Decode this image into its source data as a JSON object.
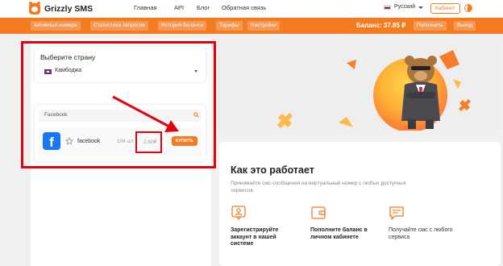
{
  "header": {
    "brand": "Grizzly SMS",
    "nav": [
      "Главная",
      "API",
      "Блог",
      "Обратная связь"
    ],
    "language": "Русский",
    "cabinet_label": "Кабинет"
  },
  "subnav": {
    "tabs": [
      "Активные номера",
      "Статистика запросов",
      "История баланса",
      "Тарифы",
      "Настройки"
    ],
    "balance": "Баланс: 37.85 ₽",
    "topup_label": "Пополнить",
    "logout_label": "Выход"
  },
  "country_card": {
    "title": "Выберите страну",
    "selected_country": "Камбоджа"
  },
  "service_card": {
    "search_value": "Facebook",
    "service": {
      "name": "facebook",
      "count": "104 шт",
      "price": "2.60₽",
      "buy_label": "КУПИТЬ"
    }
  },
  "how_it_works": {
    "title": "Как это работает",
    "subtitle": "Принимайте смс-сообщения на виртуальный номер с любых доступных сервисов",
    "steps": [
      "Зарегистрируйте аккаунт в нашей системе",
      "Пополните баланс в личном кабинете",
      "Получайте смс с любого сервиса"
    ]
  },
  "colors": {
    "accent": "#f47b20",
    "annotation": "#e3000f",
    "facebook": "#1877f2"
  }
}
